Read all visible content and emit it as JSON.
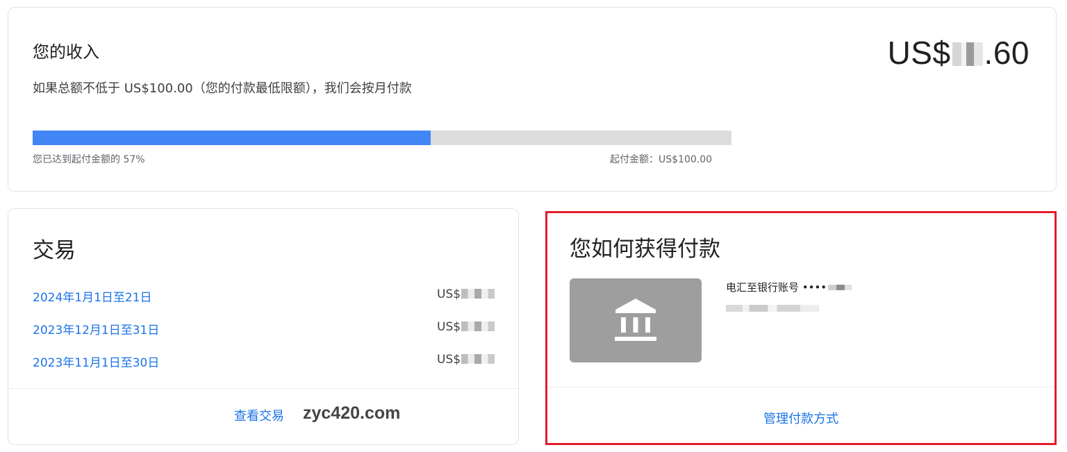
{
  "earnings": {
    "title": "您的收入",
    "amount_prefix": "US$",
    "amount_suffix": ".60",
    "description": "如果总额不低于 US$100.00（您的付款最低限额），我们会按月付款",
    "progress_percent": 57,
    "progress_label": "您已达到起付金额的 57%",
    "threshold_label": "起付金额：US$100.00"
  },
  "transactions": {
    "title": "交易",
    "rows": [
      {
        "period": "2024年1月1日至21日",
        "amount_prefix": "US$"
      },
      {
        "period": "2023年12月1日至31日",
        "amount_prefix": "US$"
      },
      {
        "period": "2023年11月1日至30日",
        "amount_prefix": "US$"
      }
    ],
    "view_link": "查看交易",
    "watermark": "zyc420.com"
  },
  "payment_method": {
    "title": "您如何获得付款",
    "method_label": "电汇至银行账号 ••••",
    "manage_link": "管理付款方式",
    "icon": "bank-icon",
    "highlight_color": "#e21b2a"
  },
  "colors": {
    "accent": "#1a73e8",
    "progress_fill": "#4285f4",
    "progress_track": "#dcdcdc"
  }
}
